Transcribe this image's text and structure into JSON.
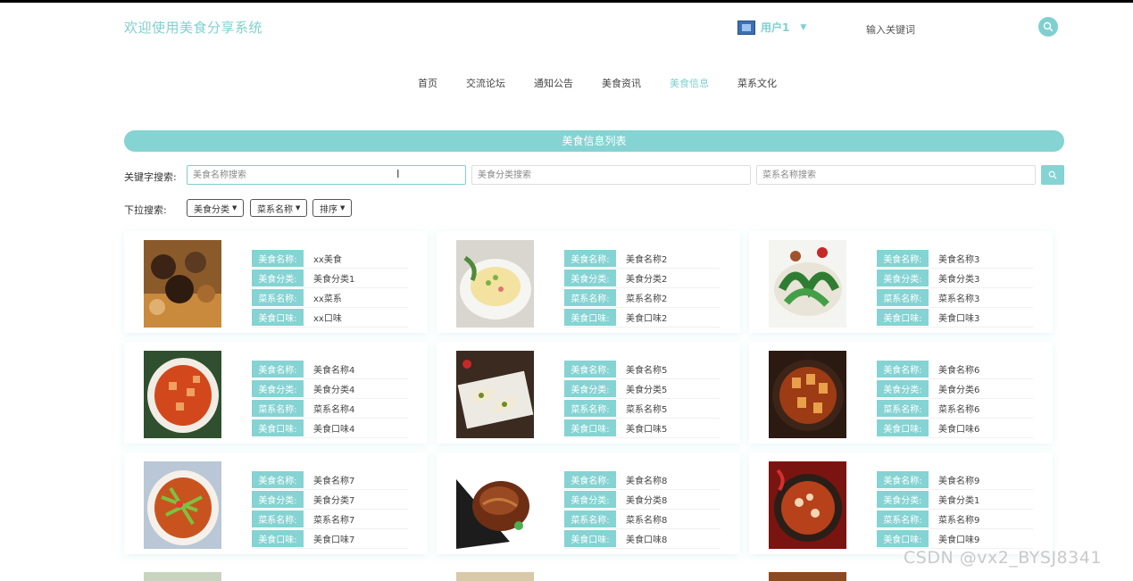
{
  "header": {
    "site_title": "欢迎使用美食分享系统",
    "user_name": "用户1",
    "search_placeholder": "输入关键词"
  },
  "nav": {
    "items": [
      {
        "label": "首页",
        "active": false
      },
      {
        "label": "交流论坛",
        "active": false
      },
      {
        "label": "通知公告",
        "active": false
      },
      {
        "label": "美食资讯",
        "active": false
      },
      {
        "label": "美食信息",
        "active": true
      },
      {
        "label": "菜系文化",
        "active": false
      }
    ]
  },
  "list": {
    "title": "美食信息列表"
  },
  "search": {
    "label": "关键字搜索:",
    "name_placeholder": "美食名称搜索",
    "category_placeholder": "美食分类搜索",
    "cuisine_placeholder": "菜系名称搜索"
  },
  "filters": {
    "label": "下拉搜索:",
    "dropdowns": [
      "美食分类",
      "菜系名称",
      "排序"
    ]
  },
  "field_labels": {
    "name": "美食名称:",
    "category": "美食分类:",
    "cuisine": "菜系名称:",
    "taste": "美食口味:"
  },
  "foods": [
    {
      "name": "xx美食",
      "category": "美食分类1",
      "cuisine": "xx菜系",
      "taste": "xx口味"
    },
    {
      "name": "美食名称2",
      "category": "美食分类2",
      "cuisine": "菜系名称2",
      "taste": "美食口味2"
    },
    {
      "name": "美食名称3",
      "category": "美食分类3",
      "cuisine": "菜系名称3",
      "taste": "美食口味3"
    },
    {
      "name": "美食名称4",
      "category": "美食分类4",
      "cuisine": "菜系名称4",
      "taste": "美食口味4"
    },
    {
      "name": "美食名称5",
      "category": "美食分类5",
      "cuisine": "菜系名称5",
      "taste": "美食口味5"
    },
    {
      "name": "美食名称6",
      "category": "美食分类6",
      "cuisine": "菜系名称6",
      "taste": "美食口味6"
    },
    {
      "name": "美食名称7",
      "category": "美食分类7",
      "cuisine": "菜系名称7",
      "taste": "美食口味7"
    },
    {
      "name": "美食名称8",
      "category": "美食分类8",
      "cuisine": "菜系名称8",
      "taste": "美食口味8"
    },
    {
      "name": "美食名称9",
      "category": "美食分类1",
      "cuisine": "菜系名称9",
      "taste": "美食口味9"
    }
  ],
  "watermark": "CSDN @vx2_BYSJ8341",
  "colors": {
    "accent": "#85d3d3",
    "accent_text": "#7fd0d0"
  }
}
